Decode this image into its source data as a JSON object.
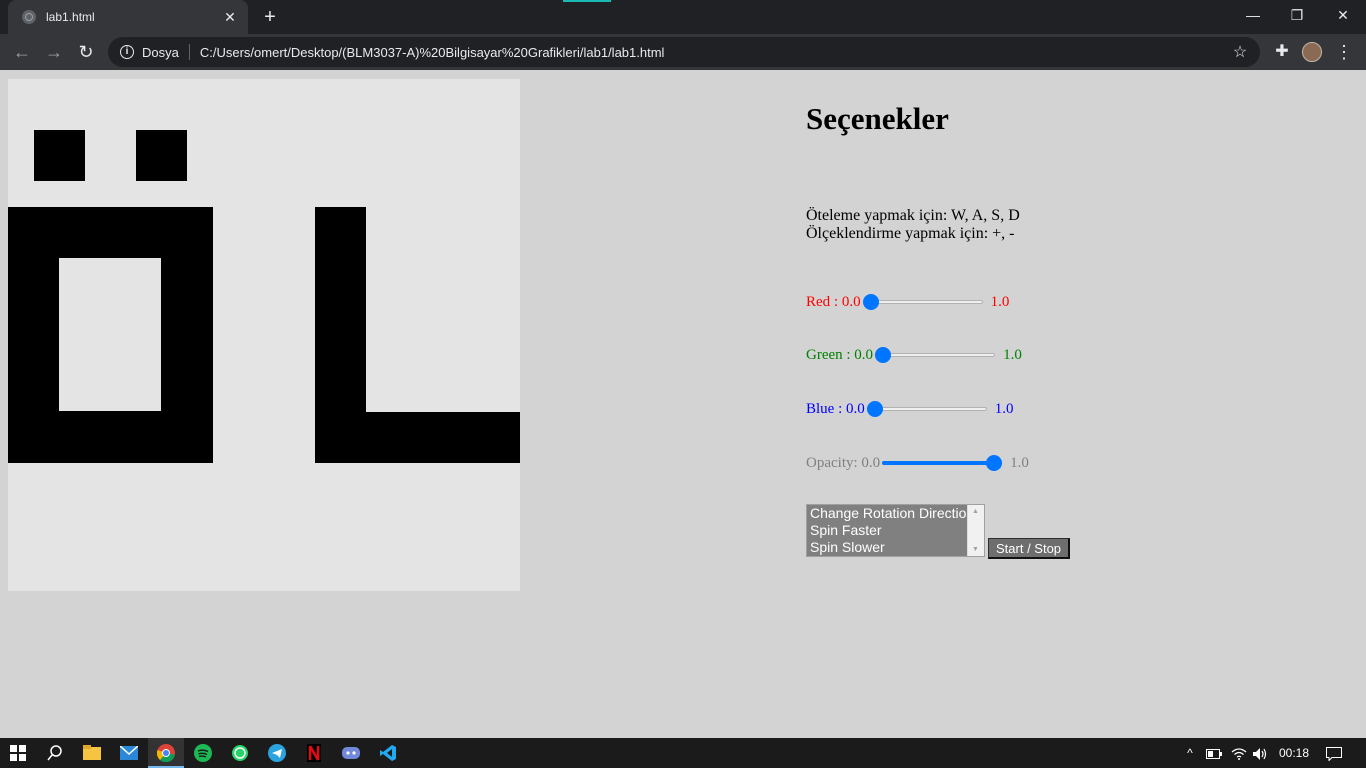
{
  "browser": {
    "tab_title": "lab1.html",
    "tab_close": "✕",
    "new_tab": "+",
    "window_controls": {
      "minimize": "—",
      "restore": "❐",
      "close": "✕"
    },
    "nav": {
      "back": "←",
      "forward": "→",
      "reload": "↻"
    },
    "site_info": "Dosya",
    "url": "C:/Users/omert/Desktop/(BLM3037-A)%20Bilgisayar%20Grafikleri/lab1/lab1.html",
    "star_icon": "☆",
    "extensions_icon": "✚",
    "menu_icon": "⋮"
  },
  "canvas": {
    "background": "#e4e4e4",
    "shape_color": "#000000"
  },
  "options": {
    "heading": "Seçenekler",
    "instructions": [
      "Öteleme yapmak için: W, A, S, D",
      "Ölçeklendirme yapmak için: +, -"
    ],
    "sliders": [
      {
        "key": "red",
        "label": "Red : 0.0",
        "max_label": "1.0",
        "value": 0.0,
        "color": "#ff0000"
      },
      {
        "key": "green",
        "label": "Green : 0.0",
        "max_label": "1.0",
        "value": 0.0,
        "color": "#008000"
      },
      {
        "key": "blue",
        "label": "Blue : 0.0",
        "max_label": "1.0",
        "value": 0.0,
        "color": "#0000ff"
      },
      {
        "key": "opacity",
        "label": "Opacity: 0.0",
        "max_label": "1.0",
        "value": 1.0,
        "color": "#808080"
      }
    ],
    "rotation_options": [
      "Change Rotation Direction",
      "Spin Faster",
      "Spin Slower"
    ],
    "start_stop_label": "Start / Stop"
  },
  "taskbar": {
    "icons": [
      "windows-start",
      "search",
      "file-explorer",
      "mail",
      "chrome",
      "spotify",
      "whatsapp",
      "telegram",
      "netflix",
      "discord",
      "vscode"
    ],
    "time": "00:18"
  }
}
